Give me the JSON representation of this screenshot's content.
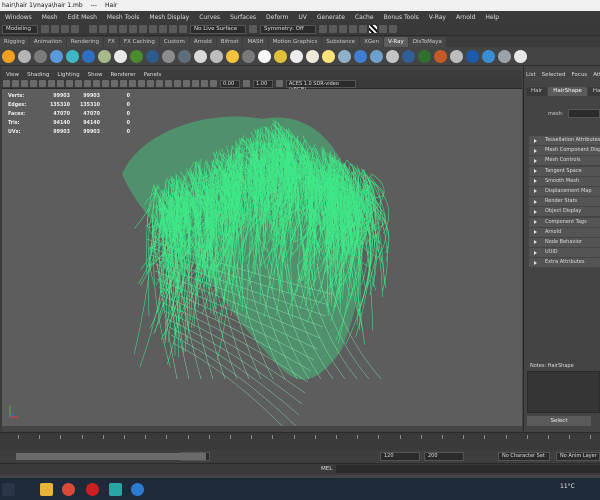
{
  "window": {
    "title_path": "hair\\hair 1\\maya\\hair 1.mb",
    "title_sep": "---",
    "title_object": "Hair"
  },
  "menubar": [
    "Windows",
    "Mesh",
    "Edit Mesh",
    "Mesh Tools",
    "Mesh Display",
    "Curves",
    "Surfaces",
    "Deform",
    "UV",
    "Generate",
    "Cache",
    "Bonus Tools",
    "V-Ray",
    "Arnold",
    "Help"
  ],
  "statusline": {
    "mode": "Modeling",
    "live_surface": "No Live Surface",
    "symmetry": "Symmetry: Off"
  },
  "shelf_tabs": [
    {
      "label": "Rigging",
      "active": false
    },
    {
      "label": "Animation",
      "active": false
    },
    {
      "label": "Rendering",
      "active": false
    },
    {
      "label": "FX",
      "active": false
    },
    {
      "label": "FX Caching",
      "active": false
    },
    {
      "label": "Custom",
      "active": false
    },
    {
      "label": "Arnold",
      "active": false
    },
    {
      "label": "Bifrost",
      "active": false
    },
    {
      "label": "MASH",
      "active": false
    },
    {
      "label": "Motion Graphics",
      "active": false
    },
    {
      "label": "Substance",
      "active": false
    },
    {
      "label": "XGen",
      "active": false
    },
    {
      "label": "V-Ray",
      "active": true
    },
    {
      "label": "DisToMaya",
      "active": false
    }
  ],
  "viewport": {
    "menus": [
      "View",
      "Shading",
      "Lighting",
      "Show",
      "Renderer",
      "Panels"
    ],
    "field_a": "0.00",
    "field_b": "1.00",
    "colorspace": "ACES 1.0 SDR-video (sRGB)",
    "hud": [
      {
        "label": "Verts:",
        "a": "99903",
        "b": "99903",
        "c": "0"
      },
      {
        "label": "Edges:",
        "a": "135310",
        "b": "135310",
        "c": "0"
      },
      {
        "label": "Faces:",
        "a": "47070",
        "b": "47070",
        "c": "0"
      },
      {
        "label": "Tris:",
        "a": "94140",
        "b": "94140",
        "c": "0"
      },
      {
        "label": "UVs:",
        "a": "99903",
        "b": "99903",
        "c": "0"
      }
    ],
    "wire_color": "#3df28a"
  },
  "attr_editor": {
    "menus": [
      "List",
      "Selected",
      "Focus",
      "Attri"
    ],
    "tabs": [
      {
        "label": "Hair",
        "active": false
      },
      {
        "label": "HairShape",
        "active": true
      },
      {
        "label": "Hair",
        "active": false
      }
    ],
    "mesh_label": "mesh:",
    "sections": [
      "Tessellation Attributes",
      "Mesh Component Display",
      "Mesh Controls",
      "Tangent Space",
      "Smooth Mesh",
      "Displacement Map",
      "Render Stats",
      "Object Display",
      "Component Tags",
      "Arnold",
      "Node Behavior",
      "UUID",
      "Extra Attributes"
    ],
    "notes_label": "Notes: HairShape",
    "select_label": "Select"
  },
  "time": {
    "range_end_display": "120",
    "start": "120",
    "end": "200",
    "no_char_set": "No Character Set",
    "no_anim_layer": "No Anim Layer",
    "mel_label": "MEL"
  },
  "taskbar": {
    "temp": "11°C"
  }
}
